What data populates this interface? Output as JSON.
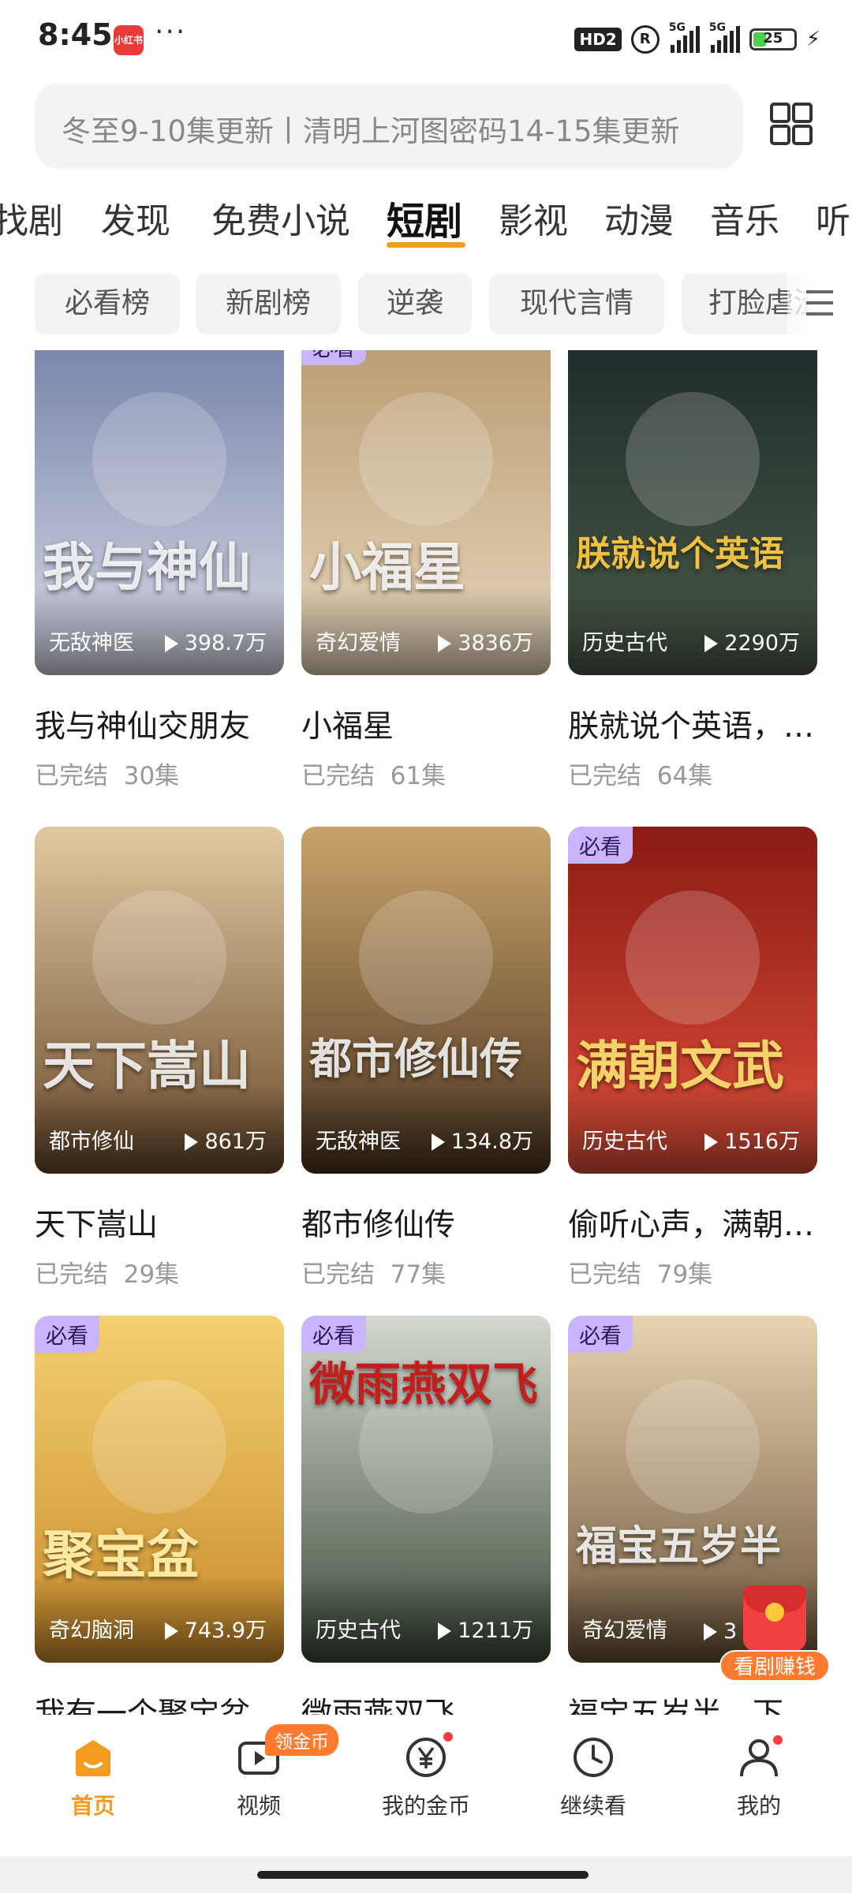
{
  "status_bar": {
    "time": "8:45",
    "app_icon_text": "小红书",
    "more": "···",
    "hd_badge": "HD2",
    "roaming": "R",
    "sim1": "5G",
    "sim2": "5G",
    "battery": "25"
  },
  "search": {
    "placeholder": "冬至9-10集更新丨清明上河图密码14-15集更新"
  },
  "tabs": [
    {
      "label": "找剧"
    },
    {
      "label": "发现"
    },
    {
      "label": "免费小说"
    },
    {
      "label": "短剧"
    },
    {
      "label": "影视"
    },
    {
      "label": "动漫"
    },
    {
      "label": "音乐"
    },
    {
      "label": "听书"
    }
  ],
  "chips": [
    {
      "label": "必看榜"
    },
    {
      "label": "新剧榜"
    },
    {
      "label": "逆袭"
    },
    {
      "label": "现代言情"
    },
    {
      "label": "打脸虐渣"
    }
  ],
  "colors": {
    "accent": "#f39c1f",
    "must_badge": "#cbb4ff",
    "earn_orange": "#ff7a2f"
  },
  "dramas": [
    {
      "title": "我与神仙交朋友",
      "status": "已完结",
      "episodes": "30集",
      "genre": "无敌神医",
      "plays": "398.7万",
      "badge": "",
      "poster_text": "我与神仙",
      "c1": "#7480a8",
      "c2": "#d9dbe6"
    },
    {
      "title": "小福星",
      "status": "已完结",
      "episodes": "61集",
      "genre": "奇幻爱情",
      "plays": "3836万",
      "badge": "必看",
      "poster_text": "小福星",
      "c1": "#b89a70",
      "c2": "#e8d8bd"
    },
    {
      "title": "朕就说个英语，你们咋都下跪了",
      "status": "已完结",
      "episodes": "64集",
      "genre": "历史古代",
      "plays": "2290万",
      "badge": "",
      "poster_text": "朕就说个英语",
      "c1": "#1e2a2a",
      "c2": "#4a5a48"
    },
    {
      "title": "天下嵩山",
      "status": "已完结",
      "episodes": "29集",
      "genre": "都市修仙",
      "plays": "861万",
      "badge": "",
      "poster_text": "天下嵩山",
      "c1": "#6a4a2c",
      "c2": "#e0c9a0"
    },
    {
      "title": "都市修仙传",
      "status": "已完结",
      "episodes": "77集",
      "genre": "无敌神医",
      "plays": "134.8万",
      "badge": "",
      "poster_text": "都市修仙传",
      "c1": "#4a3420",
      "c2": "#c9a36a"
    },
    {
      "title": "偷听心声，满朝文武",
      "status": "已完结",
      "episodes": "79集",
      "genre": "历史古代",
      "plays": "1516万",
      "badge": "必看",
      "poster_text": "满朝文武",
      "c1": "#8a1a14",
      "c2": "#e0503a"
    },
    {
      "title": "我有一个聚宝盆",
      "status": "",
      "episodes": "",
      "genre": "奇幻脑洞",
      "plays": "743.9万",
      "badge": "必看",
      "poster_text": "聚宝盆",
      "c1": "#c88a2a",
      "c2": "#f3d070"
    },
    {
      "title": "微雨燕双飞",
      "status": "",
      "episodes": "",
      "genre": "历史古代",
      "plays": "1211万",
      "badge": "必看",
      "poster_text": "微雨燕双飞",
      "c1": "#3c4a3a",
      "c2": "#d4d8cc"
    },
    {
      "title": "福宝五岁半，下山被宠",
      "status": "",
      "episodes": "",
      "genre": "奇幻爱情",
      "plays": "3",
      "badge": "必看",
      "poster_text": "福宝五岁半",
      "c1": "#6a5238",
      "c2": "#e8d4b0"
    }
  ],
  "earn_button": {
    "label": "看剧赚钱"
  },
  "coin_badge": "领金币",
  "bottom_nav": [
    {
      "label": "首页",
      "icon": "home-icon"
    },
    {
      "label": "视频",
      "icon": "video-icon"
    },
    {
      "label": "我的金币",
      "icon": "coin-icon"
    },
    {
      "label": "继续看",
      "icon": "clock-icon"
    },
    {
      "label": "我的",
      "icon": "user-icon"
    }
  ]
}
